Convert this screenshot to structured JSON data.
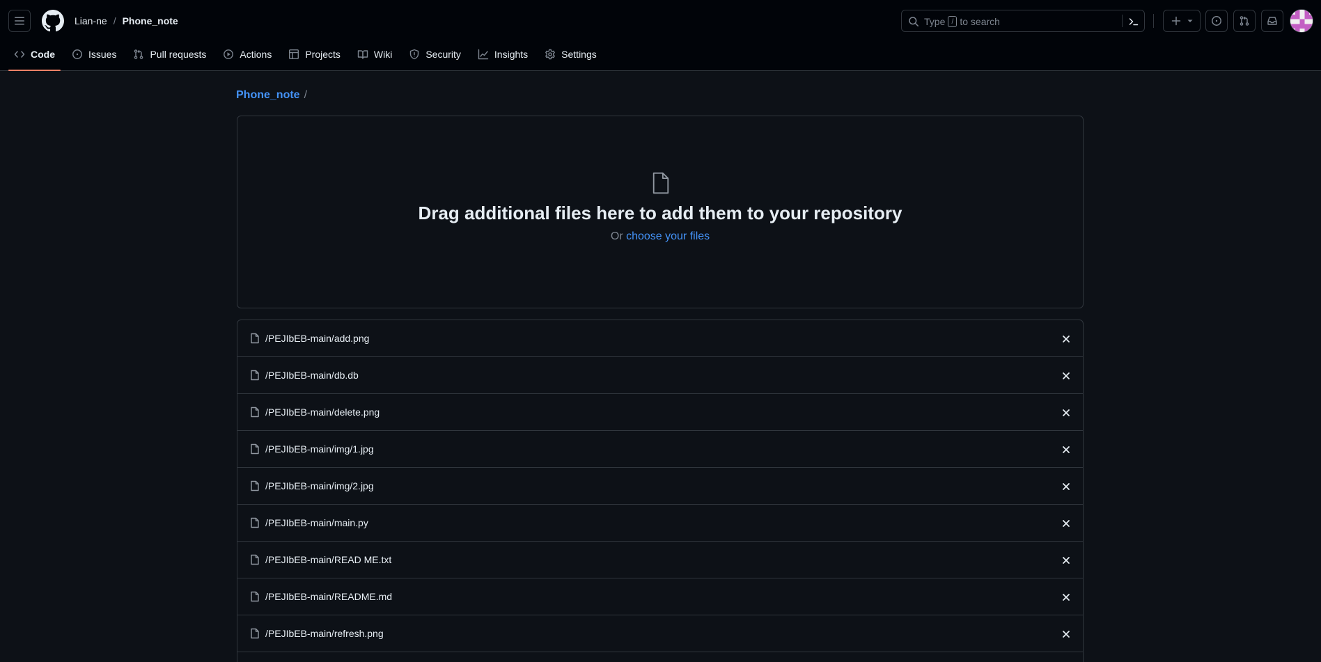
{
  "header": {
    "owner": "Lian-ne",
    "separator": "/",
    "repo": "Phone_note",
    "search": {
      "prefix": "Type",
      "key": "/",
      "suffix": "to search"
    }
  },
  "tabs": [
    {
      "label": "Code",
      "icon": "code-icon",
      "active": true
    },
    {
      "label": "Issues",
      "icon": "issue-icon"
    },
    {
      "label": "Pull requests",
      "icon": "pull-request-icon"
    },
    {
      "label": "Actions",
      "icon": "play-icon"
    },
    {
      "label": "Projects",
      "icon": "table-icon"
    },
    {
      "label": "Wiki",
      "icon": "book-icon"
    },
    {
      "label": "Security",
      "icon": "shield-icon"
    },
    {
      "label": "Insights",
      "icon": "graph-icon"
    },
    {
      "label": "Settings",
      "icon": "gear-icon"
    }
  ],
  "path": {
    "repo_link": "Phone_note",
    "separator": "/"
  },
  "dropzone": {
    "title": "Drag additional files here to add them to your repository",
    "or": "Or",
    "choose_link": "choose your files"
  },
  "files": [
    "/PEJIbEB-main/add.png",
    "/PEJIbEB-main/db.db",
    "/PEJIbEB-main/delete.png",
    "/PEJIbEB-main/img/1.jpg",
    "/PEJIbEB-main/img/2.jpg",
    "/PEJIbEB-main/main.py",
    "/PEJIbEB-main/READ ME.txt",
    "/PEJIbEB-main/README.md",
    "/PEJIbEB-main/refresh.png"
  ],
  "colors": {
    "background": "#0d1117",
    "header": "#010409",
    "border": "#30363d",
    "link": "#4493f8",
    "active_tab_underline": "#f78166",
    "muted_text": "#7d8590"
  }
}
